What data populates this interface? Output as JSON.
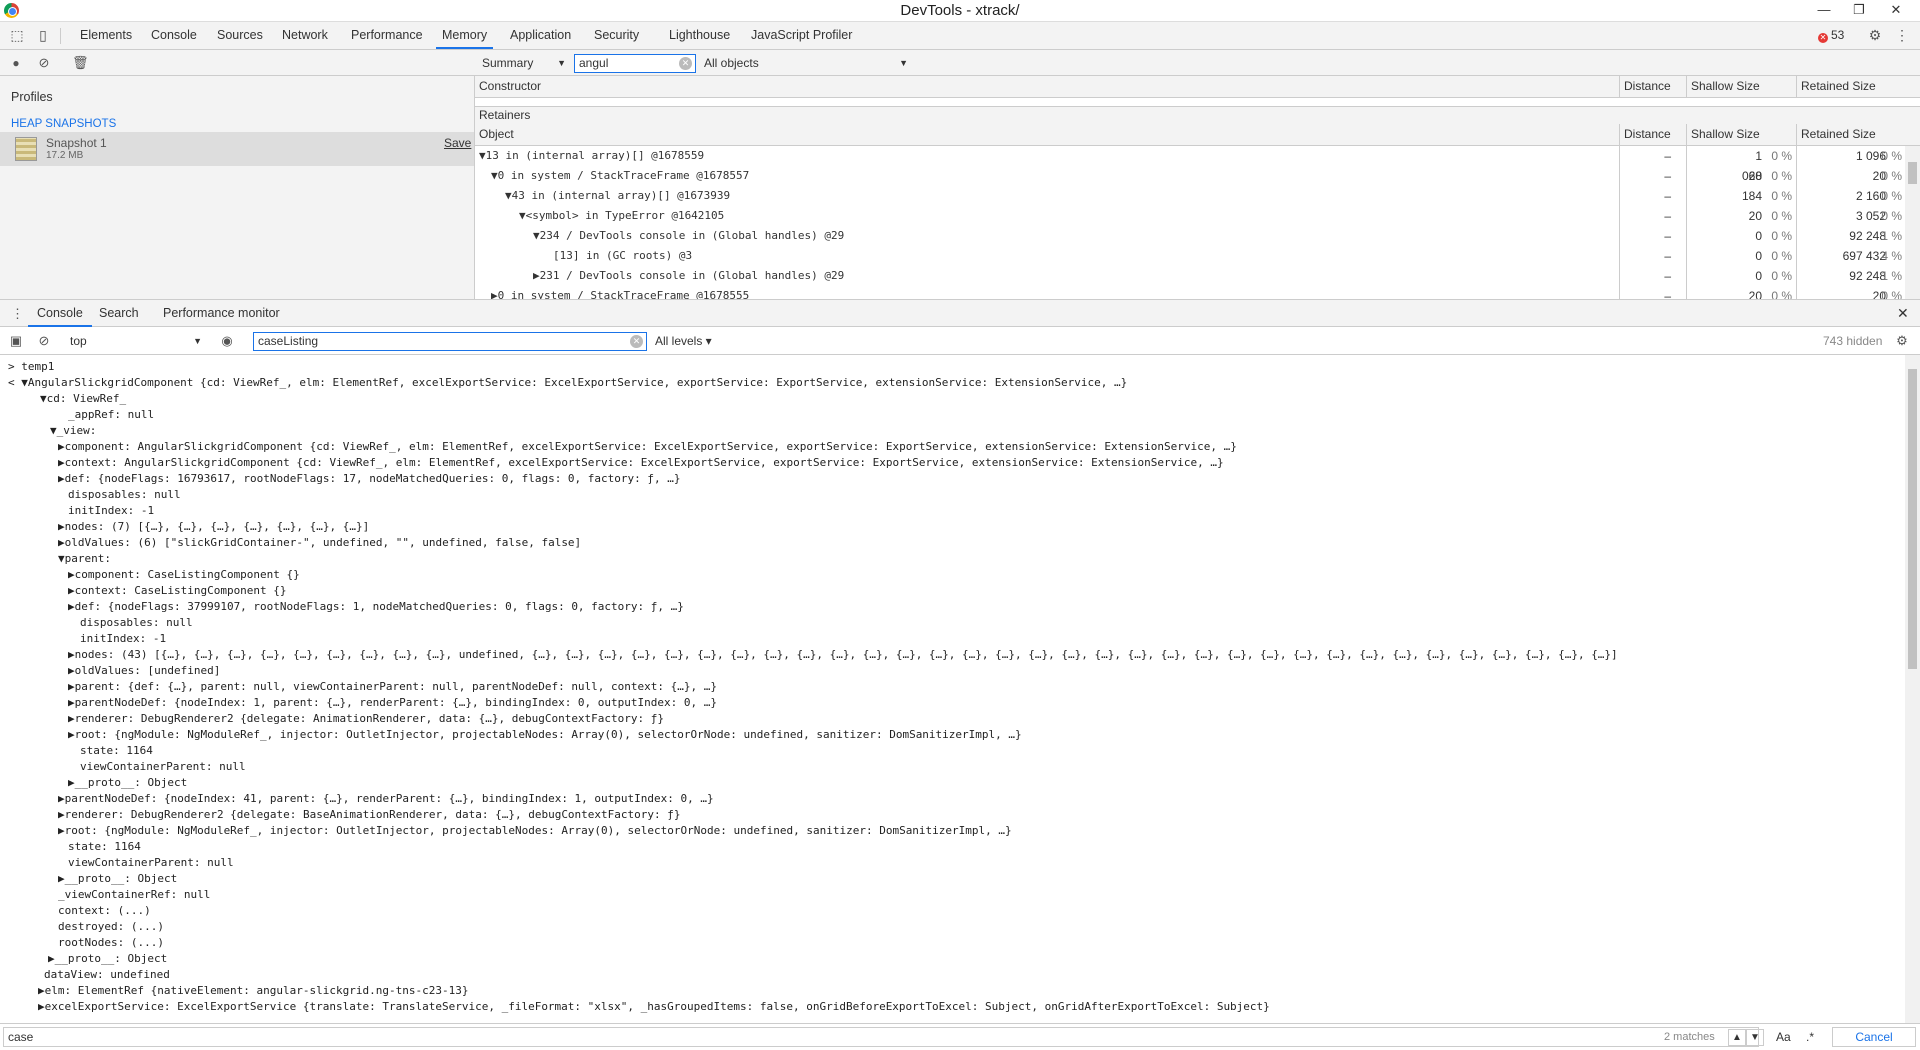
{
  "window": {
    "title": "DevTools - xtrack/"
  },
  "tabs": [
    "Elements",
    "Console",
    "Sources",
    "Network",
    "Performance",
    "Memory",
    "Application",
    "Security",
    "Lighthouse",
    "JavaScript Profiler"
  ],
  "error_count": "53",
  "memory": {
    "view_select": "Summary",
    "class_filter": "angul",
    "objects_select": "All objects",
    "profiles_label": "Profiles",
    "heap_label": "HEAP SNAPSHOTS",
    "snapshot_name": "Snapshot 1",
    "snapshot_size": "17.2 MB",
    "save_label": "Save",
    "columns": [
      "Constructor",
      "Distance",
      "Shallow Size",
      "Retained Size"
    ],
    "retainers_label": "Retainers",
    "retainer_columns": [
      "Object",
      "Distance",
      "Shallow Size",
      "Retained Size"
    ],
    "rows": [
      {
        "obj": "▼13 in (internal array)[] @1678559",
        "dist": "–",
        "shallow": "1 068",
        "sp": "0 %",
        "retained": "1 096",
        "rp": "0 %"
      },
      {
        "obj": "▼0 in system / StackTraceFrame @1678557",
        "dist": "–",
        "shallow": "20",
        "sp": "0 %",
        "retained": "20",
        "rp": "0 %"
      },
      {
        "obj": "▼43 in (internal array)[] @1673939",
        "dist": "–",
        "shallow": "184",
        "sp": "0 %",
        "retained": "2 160",
        "rp": "0 %"
      },
      {
        "obj": "▼<symbol> in TypeError @1642105",
        "dist": "–",
        "shallow": "20",
        "sp": "0 %",
        "retained": "3 052",
        "rp": "0 %"
      },
      {
        "obj": "▼234 / DevTools console in (Global handles) @29",
        "dist": "–",
        "shallow": "0",
        "sp": "0 %",
        "retained": "92 248",
        "rp": "1 %"
      },
      {
        "obj": "[13] in (GC roots) @3",
        "dist": "–",
        "shallow": "0",
        "sp": "0 %",
        "retained": "697 432",
        "rp": "4 %"
      },
      {
        "obj": "▶231 / DevTools console in (Global handles) @29",
        "dist": "–",
        "shallow": "0",
        "sp": "0 %",
        "retained": "92 248",
        "rp": "1 %"
      },
      {
        "obj": "▶0 in system / StackTraceFrame @1678555",
        "dist": "–",
        "shallow": "20",
        "sp": "0 %",
        "retained": "20",
        "rp": "0 %"
      }
    ]
  },
  "drawer": {
    "tabs": [
      "Console",
      "Search",
      "Performance monitor"
    ],
    "context": "top",
    "filter": "caseListing",
    "levels": "All levels ▾",
    "hidden": "743 hidden"
  },
  "console_lines": [
    {
      "t": "> temp1"
    },
    {
      "t": "< ▼AngularSlickgridComponent {cd: ViewRef_, elm: ElementRef, excelExportService: ExcelExportService, exportService: ExportService, extensionService: ExtensionService, …}"
    },
    {
      "t": "▼cd: ViewRef_"
    },
    {
      "t": "_appRef: null"
    },
    {
      "t": "▼_view:"
    },
    {
      "t": "▶component: AngularSlickgridComponent {cd: ViewRef_, elm: ElementRef, excelExportService: ExcelExportService, exportService: ExportService, extensionService: ExtensionService, …}"
    },
    {
      "t": "▶context: AngularSlickgridComponent {cd: ViewRef_, elm: ElementRef, excelExportService: ExcelExportService, exportService: ExportService, extensionService: ExtensionService, …}"
    },
    {
      "t": "▶def: {nodeFlags: 16793617, rootNodeFlags: 17, nodeMatchedQueries: 0, flags: 0, factory: ƒ, …}"
    },
    {
      "t": "disposables: null"
    },
    {
      "t": "initIndex: -1"
    },
    {
      "t": "▶nodes: (7) [{…}, {…}, {…}, {…}, {…}, {…}, {…}]"
    },
    {
      "t": "▶oldValues: (6) [\"slickGridContainer-\", undefined, \"\", undefined, false, false]"
    },
    {
      "t": "▼parent:"
    },
    {
      "t": "▶component: CaseListingComponent {}"
    },
    {
      "t": "▶context: CaseListingComponent {}"
    },
    {
      "t": "▶def: {nodeFlags: 37999107, rootNodeFlags: 1, nodeMatchedQueries: 0, flags: 0, factory: ƒ, …}"
    },
    {
      "t": "disposables: null"
    },
    {
      "t": "initIndex: -1"
    },
    {
      "t": "▶nodes: (43) [{…}, {…}, {…}, {…}, {…}, {…}, {…}, {…}, {…}, undefined, {…}, {…}, {…}, {…}, {…}, {…}, {…}, {…}, {…}, {…}, {…}, {…}, {…}, {…}, {…}, {…}, {…}, {…}, {…}, {…}, {…}, {…}, {…}, {…}, {…}, {…}, {…}, {…}, {…}, {…}, {…}, {…}, {…}]"
    },
    {
      "t": "▶oldValues: [undefined]"
    },
    {
      "t": "▶parent: {def: {…}, parent: null, viewContainerParent: null, parentNodeDef: null, context: {…}, …}"
    },
    {
      "t": "▶parentNodeDef: {nodeIndex: 1, parent: {…}, renderParent: {…}, bindingIndex: 0, outputIndex: 0, …}"
    },
    {
      "t": "▶renderer: DebugRenderer2 {delegate: AnimationRenderer, data: {…}, debugContextFactory: ƒ}"
    },
    {
      "t": "▶root: {ngModule: NgModuleRef_, injector: OutletInjector, projectableNodes: Array(0), selectorOrNode: undefined, sanitizer: DomSanitizerImpl, …}"
    },
    {
      "t": "state: 1164"
    },
    {
      "t": "viewContainerParent: null"
    },
    {
      "t": "▶__proto__: Object"
    },
    {
      "t": "▶parentNodeDef: {nodeIndex: 41, parent: {…}, renderParent: {…}, bindingIndex: 1, outputIndex: 0, …}"
    },
    {
      "t": "▶renderer: DebugRenderer2 {delegate: BaseAnimationRenderer, data: {…}, debugContextFactory: ƒ}"
    },
    {
      "t": "▶root: {ngModule: NgModuleRef_, injector: OutletInjector, projectableNodes: Array(0), selectorOrNode: undefined, sanitizer: DomSanitizerImpl, …}"
    },
    {
      "t": "state: 1164"
    },
    {
      "t": "viewContainerParent: null"
    },
    {
      "t": "▶__proto__: Object"
    },
    {
      "t": "_viewContainerRef: null"
    },
    {
      "t": "context: (...)"
    },
    {
      "t": "destroyed: (...)"
    },
    {
      "t": "rootNodes: (...)"
    },
    {
      "t": "▶__proto__: Object"
    },
    {
      "t": "dataView: undefined"
    },
    {
      "t": "▶elm: ElementRef {nativeElement: angular-slickgrid.ng-tns-c23-13}"
    },
    {
      "t": "▶excelExportService: ExcelExportService {translate: TranslateService, _fileFormat: \"xlsx\", _hasGroupedItems: false, onGridBeforeExportToExcel: Subject, onGridAfterExportToExcel: Subject}"
    }
  ],
  "findbar": {
    "query": "case",
    "matches": "2 matches",
    "aa": "Aa",
    "regex": ".*",
    "cancel": "Cancel"
  }
}
